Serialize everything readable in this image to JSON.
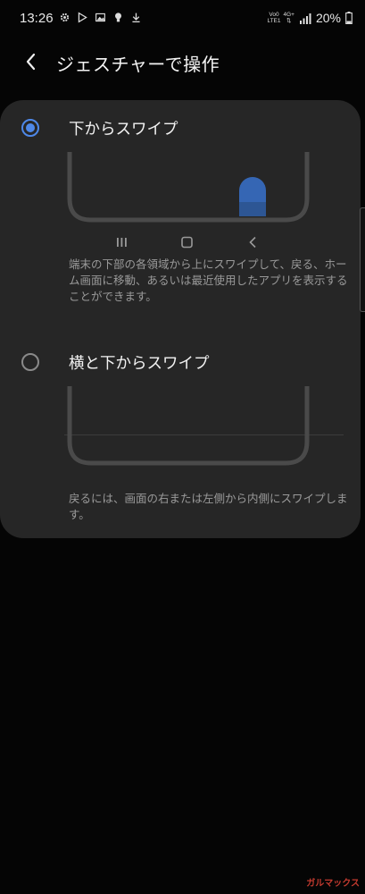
{
  "status_bar": {
    "time": "13:26",
    "network_top": "Vo0",
    "network_type": "LTE1",
    "network_gen": "4G+",
    "battery": "20%"
  },
  "header": {
    "title": "ジェスチャーで操作"
  },
  "options": [
    {
      "title": "下からスワイプ",
      "selected": true,
      "description": "端末の下部の各領域から上にスワイプして、戻る、ホーム画面に移動、あるいは最近使用したアプリを表示することができます。"
    },
    {
      "title": "横と下からスワイプ",
      "selected": false,
      "description": "戻るには、画面の右または左側から内側にスワイプします。"
    }
  ],
  "colors": {
    "accent": "#4e88e8",
    "card": "#262626",
    "background": "#050505"
  },
  "watermark": "ガルマックス"
}
